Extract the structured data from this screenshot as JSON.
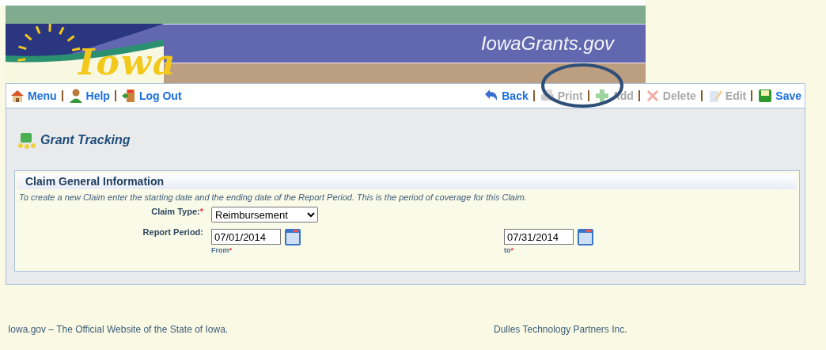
{
  "header": {
    "logo": "Iowa",
    "site_title": "IowaGrants.gov"
  },
  "toolbar": {
    "left": [
      {
        "label": "Menu",
        "disabled": false
      },
      {
        "label": "Help",
        "disabled": false
      },
      {
        "label": "Log Out",
        "disabled": false
      }
    ],
    "right": [
      {
        "label": "Back",
        "disabled": false
      },
      {
        "label": "Print",
        "disabled": true
      },
      {
        "label": "Add",
        "disabled": true
      },
      {
        "label": "Delete",
        "disabled": true
      },
      {
        "label": "Edit",
        "disabled": true
      },
      {
        "label": "Save",
        "disabled": false
      }
    ]
  },
  "page_title": "Grant Tracking",
  "section": {
    "title": "Claim General Information",
    "instructions": "To create a new Claim enter the starting date and the ending date of the Report Period. This is the period of coverage for this Claim.",
    "claim_type": {
      "label": "Claim Type:",
      "required_mark": "*",
      "value": "Reimbursement"
    },
    "report_period": {
      "label": "Report Period:",
      "from": {
        "value": "07/01/2014",
        "caption": "From",
        "required_mark": "*"
      },
      "to": {
        "value": "07/31/2014",
        "caption": "to",
        "required_mark": "*"
      }
    }
  },
  "footer": {
    "left": "Iowa.gov – The Official Website of the State of Iowa.",
    "right": "Dulles Technology Partners Inc."
  }
}
